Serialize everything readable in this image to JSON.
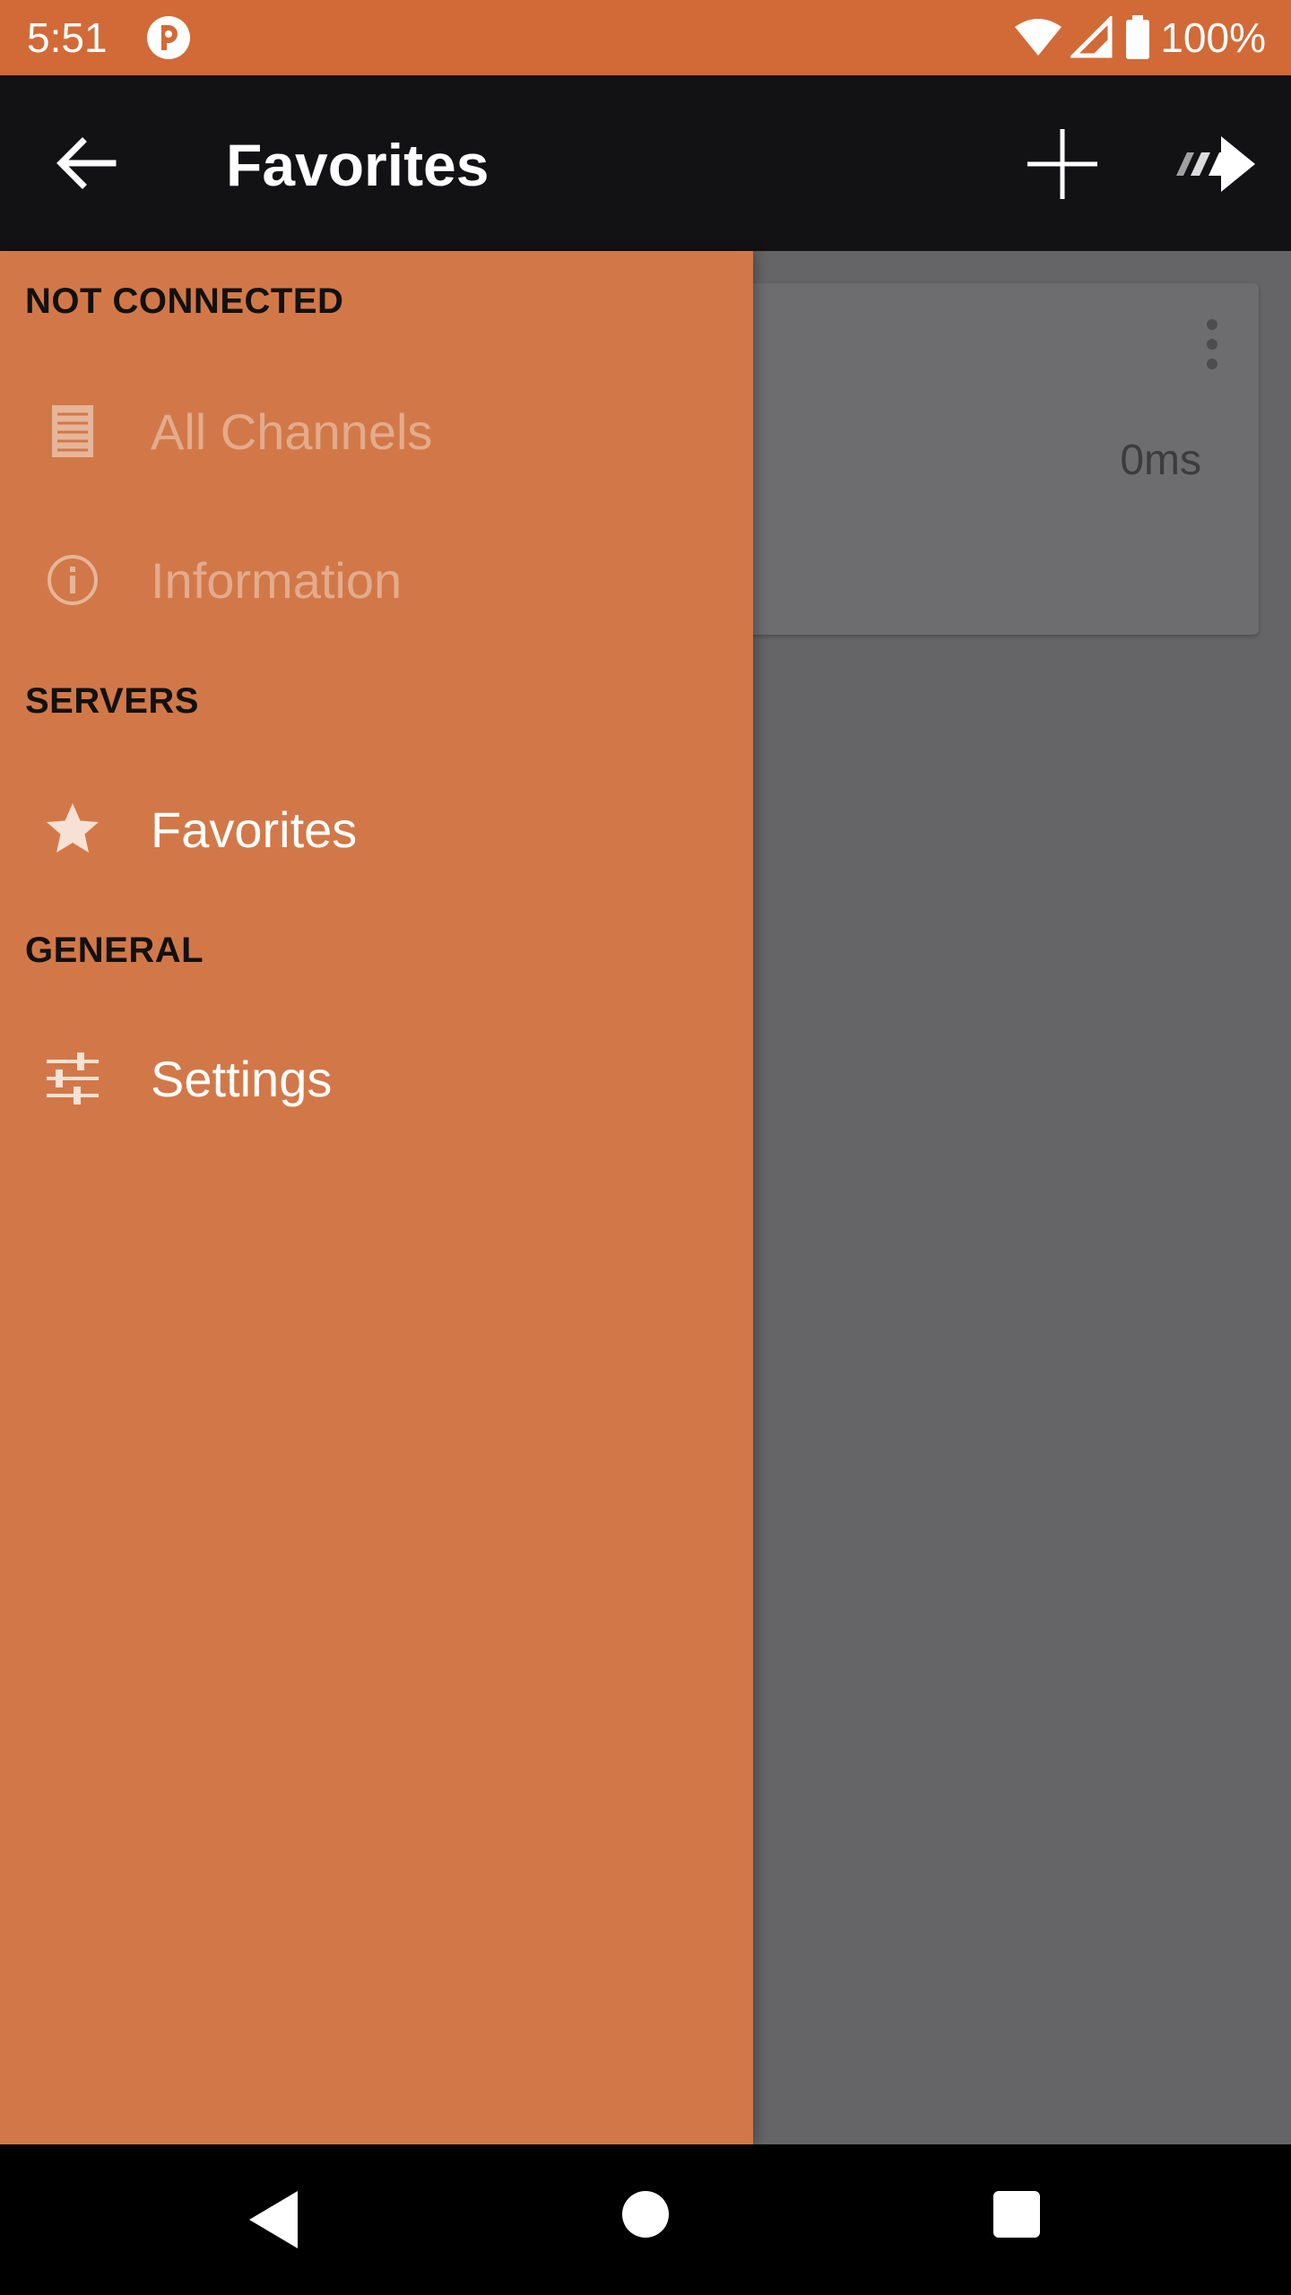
{
  "status_bar": {
    "time": "5:51",
    "battery_percent": "100%",
    "icons": [
      "app-notification-icon",
      "wifi-icon",
      "cell-signal-icon",
      "battery-icon"
    ]
  },
  "toolbar": {
    "title": "Favorites",
    "icons": [
      "back-arrow-icon",
      "add-icon",
      "connect-arrow-icon"
    ]
  },
  "background": {
    "server_card": {
      "ping": "0ms"
    }
  },
  "drawer": {
    "sections": [
      {
        "header": "NOT CONNECTED",
        "items": [
          {
            "label": "All Channels",
            "icon": "channels-list-icon",
            "enabled": false
          },
          {
            "label": "Information",
            "icon": "info-icon",
            "enabled": false
          }
        ]
      },
      {
        "header": "SERVERS",
        "items": [
          {
            "label": "Favorites",
            "icon": "star-icon",
            "enabled": true
          }
        ]
      },
      {
        "header": "GENERAL",
        "items": [
          {
            "label": "Settings",
            "icon": "sliders-icon",
            "enabled": true
          }
        ]
      }
    ]
  },
  "colors": {
    "status_bar": "#d26a37",
    "toolbar": "#121214",
    "drawer": "#d27848",
    "scrim": "#656467"
  }
}
